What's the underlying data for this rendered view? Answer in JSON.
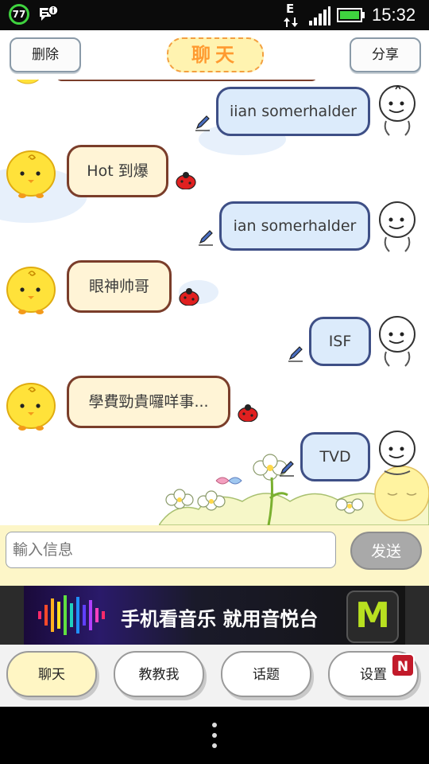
{
  "status_bar": {
    "battery_percent": "77",
    "network_type": "E",
    "time": "15:32",
    "icons": [
      "battery-ring-icon",
      "message-notification-icon",
      "network-e-icon",
      "signal-icon",
      "battery-icon"
    ]
  },
  "topbar": {
    "delete_label": "删除",
    "title": "聊天",
    "share_label": "分享"
  },
  "messages": [
    {
      "side": "out",
      "text": "iian somerhalder"
    },
    {
      "side": "in",
      "text": "Hot 到爆"
    },
    {
      "side": "out",
      "text": "ian somerhalder"
    },
    {
      "side": "in",
      "text": "眼神帅哥"
    },
    {
      "side": "out",
      "text": "ISF"
    },
    {
      "side": "in",
      "text": "學費勁貴囉咩事..."
    },
    {
      "side": "out",
      "text": "TVD"
    }
  ],
  "input": {
    "placeholder": "輸入信息",
    "send_label": "发送"
  },
  "ad": {
    "text": "手机看音乐 就用音悦台",
    "logo_letter": "M"
  },
  "bottom_nav": {
    "tabs": [
      {
        "label": "聊天",
        "active": true
      },
      {
        "label": "教教我",
        "active": false
      },
      {
        "label": "话题",
        "active": false
      },
      {
        "label": "设置",
        "active": false
      }
    ],
    "badge": "N"
  },
  "colors": {
    "incoming_bubble": "#fff4d6",
    "incoming_border": "#7a3d2a",
    "outgoing_bubble": "#dcebfb",
    "outgoing_border": "#3e4f86",
    "title_accent": "#ff9a30"
  }
}
